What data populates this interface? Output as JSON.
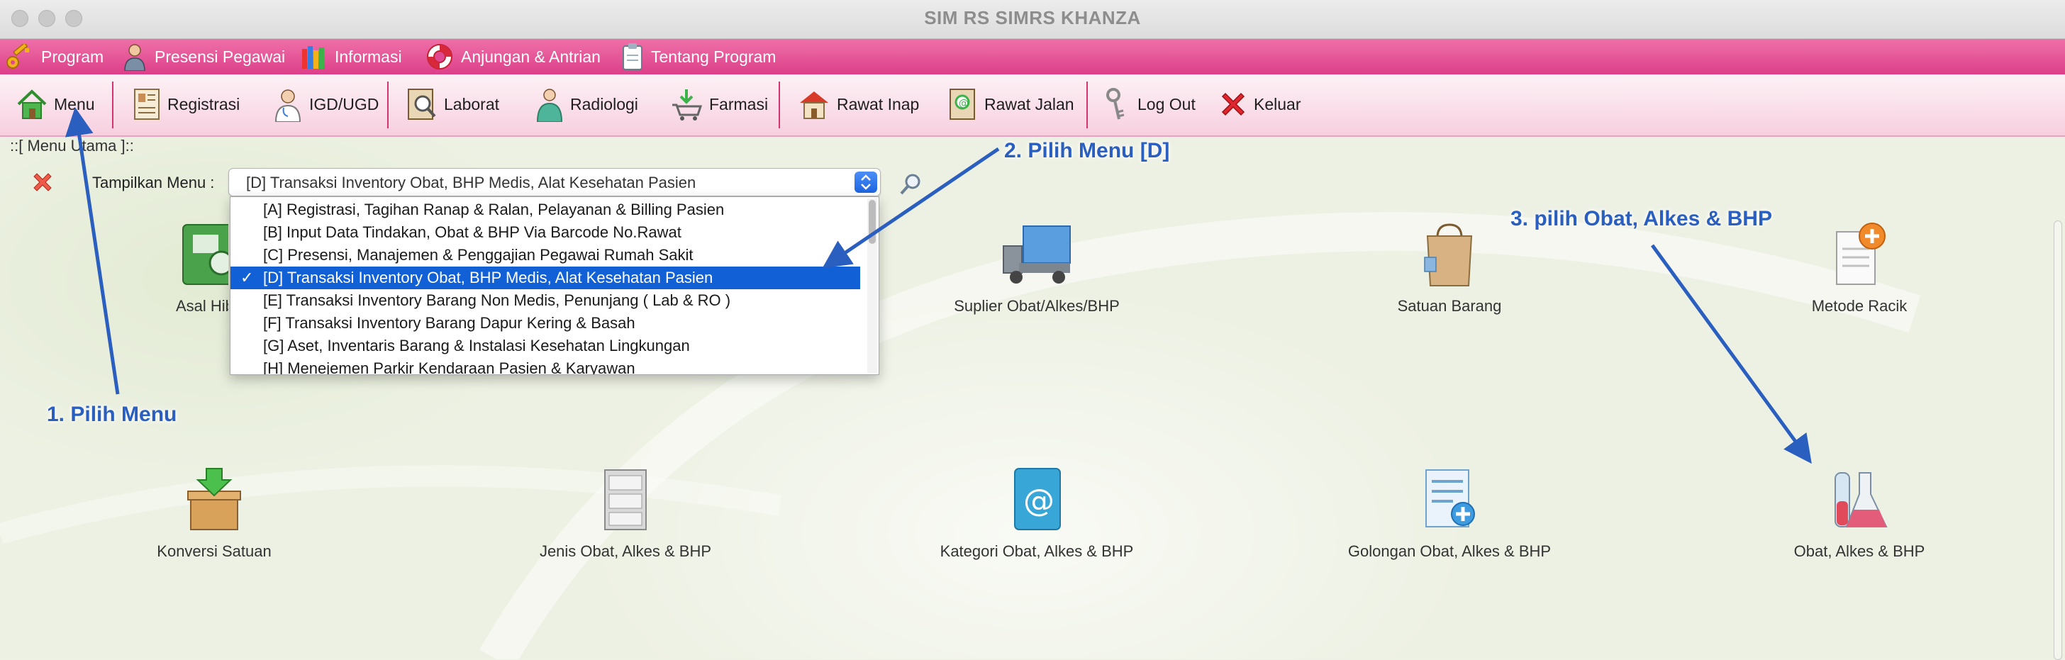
{
  "window": {
    "title": "SIM RS SIMRS KHANZA"
  },
  "menubar": {
    "items": [
      {
        "label": "Program",
        "icon": "key-icon"
      },
      {
        "label": "Presensi Pegawai",
        "icon": "employee-icon"
      },
      {
        "label": "Informasi",
        "icon": "books-icon"
      },
      {
        "label": "Anjungan & Antrian",
        "icon": "lifebuoy-icon"
      },
      {
        "label": "Tentang Program",
        "icon": "clipboard-icon"
      }
    ]
  },
  "toolbar": {
    "buttons": [
      {
        "label": "Menu",
        "icon": "home-icon"
      },
      {
        "label": "Registrasi",
        "icon": "registration-form-icon"
      },
      {
        "label": "IGD/UGD",
        "icon": "doctor-icon"
      },
      {
        "label": "Laborat",
        "icon": "lab-icon"
      },
      {
        "label": "Radiologi",
        "icon": "radiologist-icon"
      },
      {
        "label": "Farmasi",
        "icon": "pharmacy-cart-icon"
      },
      {
        "label": "Rawat Inap",
        "icon": "hospital-house-icon"
      },
      {
        "label": "Rawat Jalan",
        "icon": "outpatient-icon"
      },
      {
        "label": "Log Out",
        "icon": "keys-icon"
      },
      {
        "label": "Keluar",
        "icon": "red-x-icon"
      }
    ]
  },
  "main": {
    "breadcrumb": "::[ Menu Utama ]::",
    "filter_label": "Tampilkan Menu :",
    "selected_menu": "[D] Transaksi Inventory Obat, BHP Medis, Alat Kesehatan Pasien",
    "dropdown_options": [
      {
        "label": "[A] Registrasi, Tagihan Ranap & Ralan, Pelayanan & Billing Pasien",
        "check": ""
      },
      {
        "label": "[B] Input Data Tindakan, Obat & BHP Via Barcode No.Rawat",
        "check": ""
      },
      {
        "label": "[C] Presensi, Manajemen & Penggajian Pegawai Rumah Sakit",
        "check": ""
      },
      {
        "label": "[D] Transaksi Inventory Obat, BHP Medis, Alat Kesehatan Pasien",
        "check": "✓"
      },
      {
        "label": "[E] Transaksi Inventory Barang Non Medis, Penunjang ( Lab & RO )",
        "check": ""
      },
      {
        "label": "[F] Transaksi Inventory Barang Dapur Kering & Basah",
        "check": ""
      },
      {
        "label": "[G] Aset, Inventaris Barang & Instalasi Kesehatan Lingkungan",
        "check": ""
      },
      {
        "label": "[H] Menejemen Parkir Kendaraan Pasien & Karyawan",
        "check": ""
      }
    ],
    "tiles_row1": [
      {
        "label": "Asal Hibah",
        "icon": "cash-register-icon"
      },
      {
        "label": "Suplier Obat/Alkes/BHP",
        "icon": "delivery-truck-icon"
      },
      {
        "label": "Satuan Barang",
        "icon": "shopping-bag-icon"
      },
      {
        "label": "Metode Racik",
        "icon": "document-add-icon"
      }
    ],
    "tiles_row2": [
      {
        "label": "Konversi Satuan",
        "icon": "box-download-icon"
      },
      {
        "label": "Jenis Obat, Alkes & BHP",
        "icon": "filing-cabinet-icon"
      },
      {
        "label": "Kategori Obat, Alkes & BHP",
        "icon": "address-book-icon"
      },
      {
        "label": "Golongan Obat, Alkes & BHP",
        "icon": "list-add-icon"
      },
      {
        "label": "Obat, Alkes & BHP",
        "icon": "lab-flasks-icon"
      }
    ]
  },
  "annotations": {
    "step1": "1. Pilih Menu",
    "step2": "2. Pilih Menu [D]",
    "step3": "3. pilih Obat, Alkes & BHP",
    "color": "#2a5fc0"
  },
  "colors": {
    "menubar": "#e0498f",
    "toolbar": "#f9d6e4",
    "selection": "#1160d6"
  }
}
